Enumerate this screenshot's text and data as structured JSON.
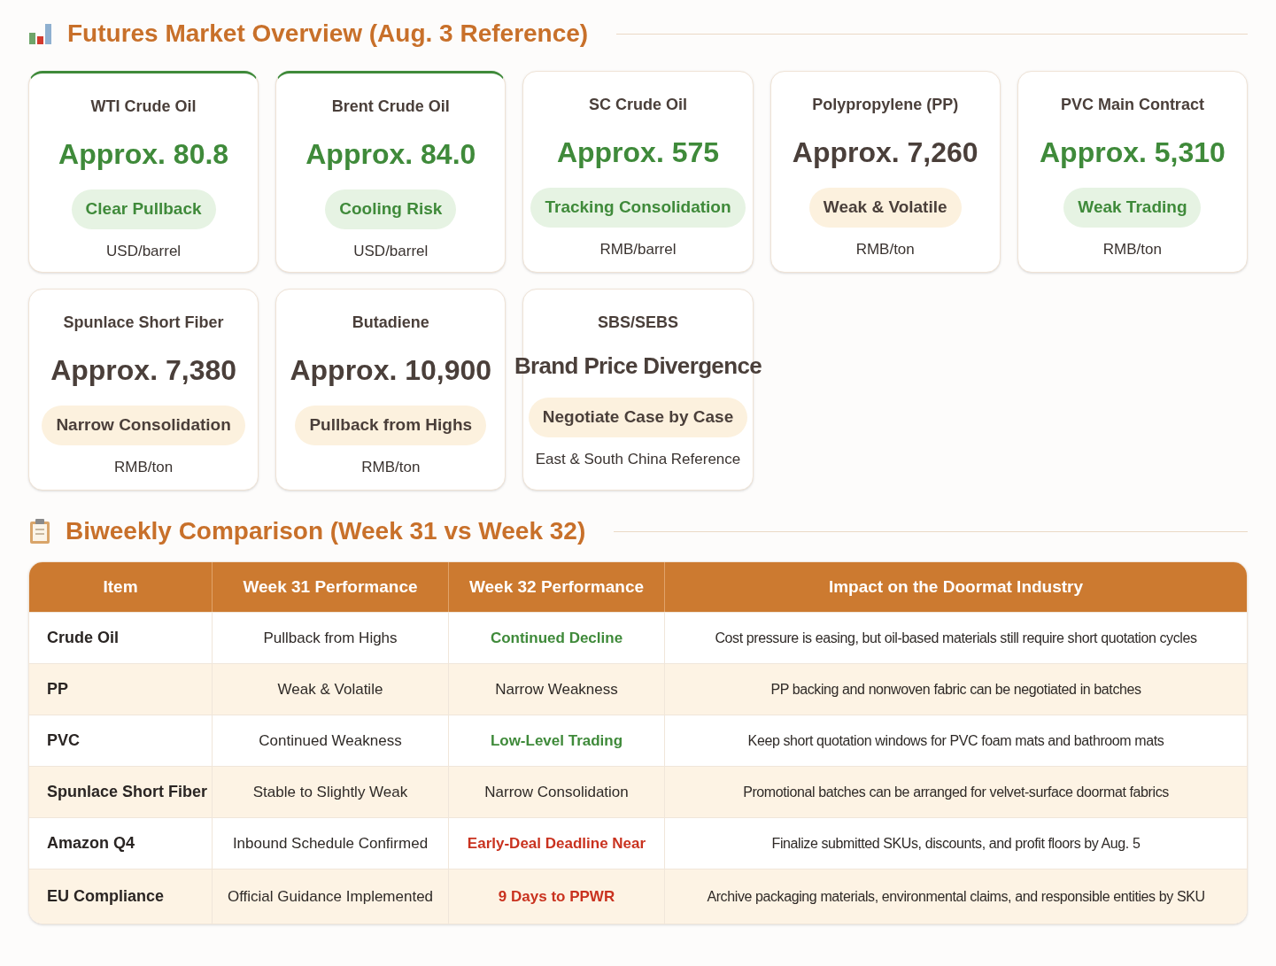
{
  "overview": {
    "title": "Futures Market Overview (Aug. 3 Reference)",
    "cards": [
      {
        "name": "WTI Crude Oil",
        "value": "Approx. 80.8",
        "badge": "Clear Pullback",
        "unit": "USD/barrel",
        "positive": true,
        "highlighted": true
      },
      {
        "name": "Brent Crude Oil",
        "value": "Approx. 84.0",
        "badge": "Cooling Risk",
        "unit": "USD/barrel",
        "positive": true,
        "highlighted": true
      },
      {
        "name": "SC Crude Oil",
        "value": "Approx. 575",
        "badge": "Tracking Consolidation",
        "unit": "RMB/barrel",
        "positive": true,
        "highlighted": false
      },
      {
        "name": "Polypropylene (PP)",
        "value": "Approx. 7,260",
        "badge": "Weak & Volatile",
        "unit": "RMB/ton",
        "positive": false,
        "highlighted": false
      },
      {
        "name": "PVC Main Contract",
        "value": "Approx. 5,310",
        "badge": "Weak Trading",
        "unit": "RMB/ton",
        "positive": true,
        "highlighted": false
      },
      {
        "name": "Spunlace Short Fiber",
        "value": "Approx. 7,380",
        "badge": "Narrow Consolidation",
        "unit": "RMB/ton",
        "positive": false,
        "highlighted": false
      },
      {
        "name": "Butadiene",
        "value": "Approx. 10,900",
        "badge": "Pullback from Highs",
        "unit": "RMB/ton",
        "positive": false,
        "highlighted": false
      },
      {
        "name": "SBS/SEBS",
        "value": "Brand Price Divergence",
        "badge": "Negotiate Case by Case",
        "unit": "East & South China Reference",
        "positive": false,
        "highlighted": false
      }
    ]
  },
  "comparison": {
    "title": "Biweekly Comparison (Week 31 vs Week 32)",
    "columns": [
      "Item",
      "Week 31 Performance",
      "Week 32 Performance",
      "Impact on the Doormat Industry"
    ],
    "rows": [
      {
        "item": "Crude Oil",
        "week31": "Pullback from Highs",
        "week32": "Continued Decline",
        "week32_positive": true,
        "week32_alert": false,
        "impact": "Cost pressure is easing, but oil-based materials still require short quotation cycles"
      },
      {
        "item": "PP",
        "week31": "Weak & Volatile",
        "week32": "Narrow Weakness",
        "week32_positive": false,
        "week32_alert": false,
        "impact": "PP backing and nonwoven fabric can be negotiated in batches"
      },
      {
        "item": "PVC",
        "week31": "Continued Weakness",
        "week32": "Low-Level Trading",
        "week32_positive": true,
        "week32_alert": false,
        "impact": "Keep short quotation windows for PVC foam mats and bathroom mats"
      },
      {
        "item": "Spunlace Short Fiber",
        "week31": "Stable to Slightly Weak",
        "week32": "Narrow Consolidation",
        "week32_positive": false,
        "week32_alert": false,
        "impact": "Promotional batches can be arranged for velvet-surface doormat fabrics"
      },
      {
        "item": "Amazon Q4",
        "week31": "Inbound Schedule Confirmed",
        "week32": "Early-Deal Deadline Near",
        "week32_positive": false,
        "week32_alert": true,
        "impact": "Finalize submitted SKUs, discounts, and profit floors by Aug. 5"
      },
      {
        "item": "EU Compliance",
        "week31": "Official Guidance Implemented",
        "week32": "9 Days to PPWR",
        "week32_positive": false,
        "week32_alert": true,
        "impact": "Archive packaging materials, environmental claims, and responsible entities by SKU"
      }
    ]
  }
}
